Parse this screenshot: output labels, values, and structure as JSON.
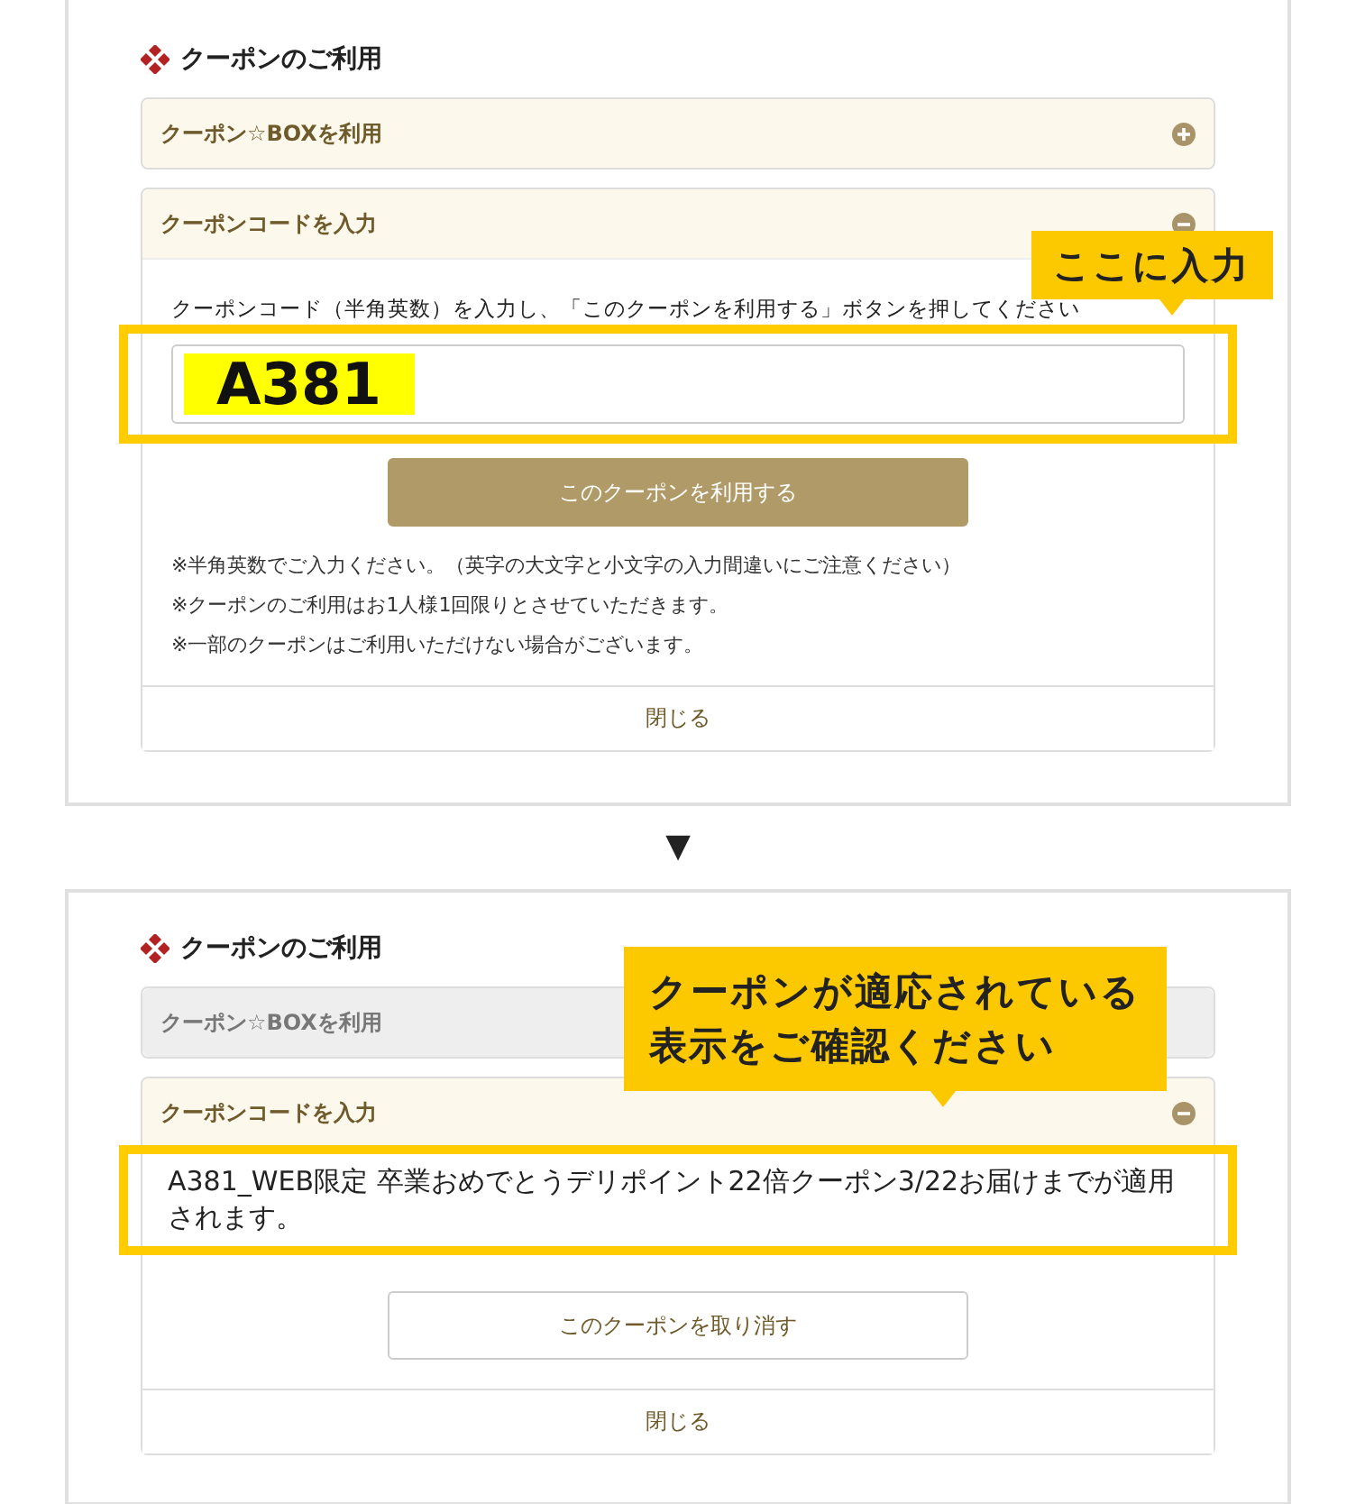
{
  "panels": [
    {
      "kind": "entry",
      "heading": "クーポンのご利用",
      "box_section": {
        "title": "クーポン☆BOXを利用",
        "expanded": false,
        "disabled": false
      },
      "code_section": {
        "title": "クーポンコードを入力",
        "expanded": true,
        "instruction": "クーポンコード（半角英数）を入力し、「このクーポンを利用する」ボタンを押してください",
        "input": {
          "value": "A381",
          "highlighted": true
        },
        "button": {
          "label": "このクーポンを利用する",
          "kind": "primary"
        },
        "notes": [
          "※半角英数でご入力ください。（英字の大文字と小文字の入力間違いにご注意ください）",
          "※クーポンのご利用はお1人様1回限りとさせていただきます。",
          "※一部のクーポンはご利用いただけない場合がございます。"
        ],
        "close": "閉じる"
      },
      "callout": {
        "lines": [
          "ここに入力"
        ]
      }
    },
    {
      "kind": "applied",
      "heading": "クーポンのご利用",
      "box_section": {
        "title": "クーポン☆BOXを利用",
        "expanded": false,
        "disabled": true
      },
      "code_section": {
        "title": "クーポンコードを入力",
        "expanded": true,
        "message": "A381_WEB限定 卒業おめでとうデリポイント22倍クーポン3/22お届けまでが適用されます。",
        "button": {
          "label": "このクーポンを取り消す",
          "kind": "secondary"
        },
        "close": "閉じる"
      },
      "callout": {
        "lines": [
          "クーポンが適応されている",
          "表示をご確認ください"
        ]
      }
    }
  ],
  "step_arrow": "▼"
}
